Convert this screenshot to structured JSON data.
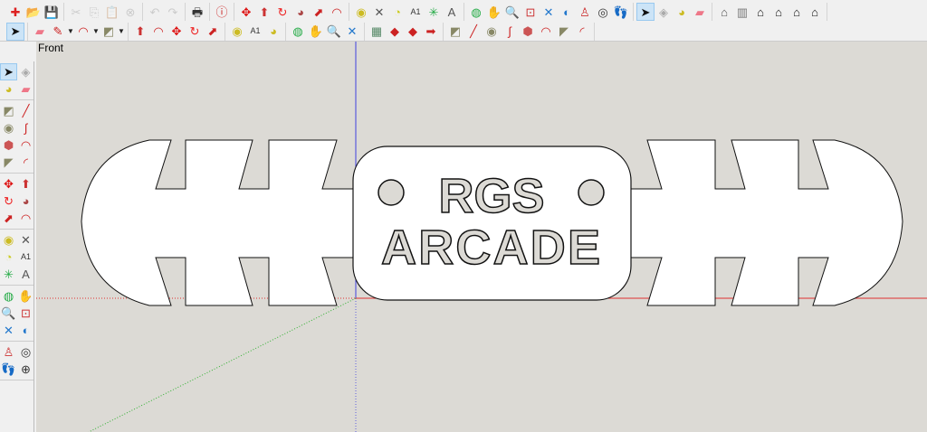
{
  "toolbar_row1": [
    [
      {
        "icon": "new-file-icon",
        "g": "✚",
        "c": "#d22"
      },
      {
        "icon": "open-folder-icon",
        "g": "📂",
        "c": "#6a5"
      },
      {
        "icon": "save-icon",
        "g": "💾",
        "c": "#247"
      }
    ],
    [
      {
        "icon": "cut-icon",
        "g": "✂",
        "c": "#888",
        "d": 1
      },
      {
        "icon": "copy-icon",
        "g": "⎘",
        "c": "#888",
        "d": 1
      },
      {
        "icon": "paste-icon",
        "g": "📋",
        "c": "#888",
        "d": 1
      },
      {
        "icon": "erase-icon",
        "g": "⊗",
        "c": "#888",
        "d": 1
      }
    ],
    [
      {
        "icon": "undo-icon",
        "g": "↶",
        "c": "#888",
        "d": 1
      },
      {
        "icon": "redo-icon",
        "g": "↷",
        "c": "#888",
        "d": 1
      }
    ],
    [
      {
        "icon": "print-icon",
        "g": "🖶",
        "c": "#333"
      }
    ],
    [
      {
        "icon": "model-info-icon",
        "g": "ⓘ",
        "c": "#c22"
      }
    ],
    [
      {
        "icon": "move-icon",
        "g": "✥",
        "c": "#d11"
      },
      {
        "icon": "push-pull-icon",
        "g": "⬆",
        "c": "#c33"
      },
      {
        "icon": "rotate-icon",
        "g": "↻",
        "c": "#e22"
      },
      {
        "icon": "follow-me-icon",
        "g": "◕",
        "c": "#a44"
      },
      {
        "icon": "scale-icon",
        "g": "⬈",
        "c": "#c22"
      },
      {
        "icon": "offset-icon",
        "g": "◠",
        "c": "#c22"
      }
    ],
    [
      {
        "icon": "tape-measure-icon",
        "g": "◉",
        "c": "#cb2"
      },
      {
        "icon": "dimension-icon",
        "g": "✕",
        "c": "#555"
      },
      {
        "icon": "protractor-icon",
        "g": "◔",
        "c": "#cc2"
      },
      {
        "icon": "text-icon",
        "g": "A1",
        "c": "#333"
      },
      {
        "icon": "axes-icon",
        "g": "✳",
        "c": "#2a4"
      },
      {
        "icon": "3d-text-icon",
        "g": "A",
        "c": "#555"
      }
    ],
    [
      {
        "icon": "orbit-icon",
        "g": "◍",
        "c": "#2a4"
      },
      {
        "icon": "pan-icon",
        "g": "✋",
        "c": "#777"
      },
      {
        "icon": "zoom-icon",
        "g": "🔍",
        "c": "#24a"
      },
      {
        "icon": "zoom-window-icon",
        "g": "⊡",
        "c": "#c33"
      },
      {
        "icon": "zoom-extents-icon",
        "g": "✕",
        "c": "#27c"
      },
      {
        "icon": "previous-view-icon",
        "g": "◐",
        "c": "#27c"
      },
      {
        "icon": "position-camera-icon",
        "g": "♙",
        "c": "#c33"
      },
      {
        "icon": "look-around-icon",
        "g": "◎",
        "c": "#333"
      },
      {
        "icon": "walk-icon",
        "g": "👣",
        "c": "#111"
      }
    ],
    [
      {
        "icon": "select-icon",
        "g": "➤",
        "c": "#111",
        "s": 1
      },
      {
        "icon": "make-component-icon",
        "g": "◈",
        "c": "#aaa"
      },
      {
        "icon": "paint-bucket-icon",
        "g": "◕",
        "c": "#cb2"
      },
      {
        "icon": "eraser-icon",
        "g": "▰",
        "c": "#e78"
      }
    ],
    [
      {
        "icon": "iso-view-icon",
        "g": "⌂",
        "c": "#555"
      },
      {
        "icon": "top-view-icon",
        "g": "▥",
        "c": "#777"
      },
      {
        "icon": "front-view-icon",
        "g": "⌂",
        "c": "#111"
      },
      {
        "icon": "right-view-icon",
        "g": "⌂",
        "c": "#111"
      },
      {
        "icon": "back-view-icon",
        "g": "⌂",
        "c": "#111"
      },
      {
        "icon": "left-view-icon",
        "g": "⌂",
        "c": "#111"
      }
    ]
  ],
  "toolbar_row2": [
    [
      {
        "icon": "select-icon",
        "g": "➤",
        "c": "#111",
        "s": 1
      }
    ],
    [
      {
        "icon": "eraser-icon",
        "g": "▰",
        "c": "#e78"
      },
      {
        "icon": "pencil-icon",
        "g": "✎",
        "c": "#c22",
        "dd": 1
      },
      {
        "icon": "arc-icon",
        "g": "◠",
        "c": "#c22",
        "dd": 1
      },
      {
        "icon": "rectangle-icon",
        "g": "◩",
        "c": "#886",
        "dd": 1
      }
    ],
    [
      {
        "icon": "push-pull-icon",
        "g": "⬆",
        "c": "#c33"
      },
      {
        "icon": "offset-icon",
        "g": "◠",
        "c": "#c22"
      },
      {
        "icon": "move-icon",
        "g": "✥",
        "c": "#d11"
      },
      {
        "icon": "rotate-icon",
        "g": "↻",
        "c": "#e22"
      },
      {
        "icon": "scale-icon",
        "g": "⬈",
        "c": "#c22"
      }
    ],
    [
      {
        "icon": "tape-measure-icon",
        "g": "◉",
        "c": "#cb2"
      },
      {
        "icon": "text-icon",
        "g": "A1",
        "c": "#333"
      },
      {
        "icon": "paint-bucket-icon",
        "g": "◕",
        "c": "#cb2"
      }
    ],
    [
      {
        "icon": "orbit-icon",
        "g": "◍",
        "c": "#2a4"
      },
      {
        "icon": "pan-icon",
        "g": "✋",
        "c": "#777"
      },
      {
        "icon": "zoom-icon",
        "g": "🔍",
        "c": "#24a"
      },
      {
        "icon": "zoom-extents-icon",
        "g": "✕",
        "c": "#27c"
      }
    ],
    [
      {
        "icon": "3d-warehouse-icon",
        "g": "▦",
        "c": "#586"
      },
      {
        "icon": "extension-warehouse-icon",
        "g": "◆",
        "c": "#c22"
      },
      {
        "icon": "share-model-icon",
        "g": "◆",
        "c": "#c22"
      },
      {
        "icon": "send-to-layout-icon",
        "g": "➡",
        "c": "#c22"
      }
    ],
    [
      {
        "icon": "rectangle-icon",
        "g": "◩",
        "c": "#886"
      },
      {
        "icon": "line-icon",
        "g": "╱",
        "c": "#c22"
      },
      {
        "icon": "circle-icon",
        "g": "◉",
        "c": "#886"
      },
      {
        "icon": "freehand-icon",
        "g": "∫",
        "c": "#c22"
      },
      {
        "icon": "polygon-icon",
        "g": "⬢",
        "c": "#c55"
      },
      {
        "icon": "arc-icon",
        "g": "◠",
        "c": "#c22"
      },
      {
        "icon": "pie-icon",
        "g": "◤",
        "c": "#886"
      },
      {
        "icon": "two-point-arc-icon",
        "g": "◜",
        "c": "#c22"
      }
    ]
  ],
  "left_toolbar": [
    [
      {
        "icon": "select-icon",
        "g": "➤",
        "c": "#111",
        "s": 1
      },
      {
        "icon": "make-component-icon",
        "g": "◈",
        "c": "#aaa"
      },
      {
        "icon": "paint-bucket-icon",
        "g": "◕",
        "c": "#cb2"
      },
      {
        "icon": "eraser-icon",
        "g": "▰",
        "c": "#e78"
      }
    ],
    [
      {
        "icon": "rectangle-icon",
        "g": "◩",
        "c": "#886"
      },
      {
        "icon": "line-icon",
        "g": "╱",
        "c": "#c22"
      },
      {
        "icon": "circle-icon",
        "g": "◉",
        "c": "#886"
      },
      {
        "icon": "freehand-icon",
        "g": "∫",
        "c": "#c22"
      },
      {
        "icon": "polygon-icon",
        "g": "⬢",
        "c": "#c55"
      },
      {
        "icon": "arc-icon",
        "g": "◠",
        "c": "#c22"
      },
      {
        "icon": "pie-icon",
        "g": "◤",
        "c": "#886"
      },
      {
        "icon": "two-point-arc-icon",
        "g": "◜",
        "c": "#c22"
      }
    ],
    [
      {
        "icon": "move-icon",
        "g": "✥",
        "c": "#d11"
      },
      {
        "icon": "push-pull-icon",
        "g": "⬆",
        "c": "#c33"
      },
      {
        "icon": "rotate-icon",
        "g": "↻",
        "c": "#e22"
      },
      {
        "icon": "follow-me-icon",
        "g": "◕",
        "c": "#a44"
      },
      {
        "icon": "scale-icon",
        "g": "⬈",
        "c": "#c22"
      },
      {
        "icon": "offset-icon",
        "g": "◠",
        "c": "#c22"
      }
    ],
    [
      {
        "icon": "tape-measure-icon",
        "g": "◉",
        "c": "#cb2"
      },
      {
        "icon": "dimension-icon",
        "g": "✕",
        "c": "#555"
      },
      {
        "icon": "protractor-icon",
        "g": "◔",
        "c": "#cc2"
      },
      {
        "icon": "text-icon",
        "g": "A1",
        "c": "#333"
      },
      {
        "icon": "axes-icon",
        "g": "✳",
        "c": "#2a4"
      },
      {
        "icon": "3d-text-icon",
        "g": "A",
        "c": "#555"
      }
    ],
    [
      {
        "icon": "orbit-icon",
        "g": "◍",
        "c": "#2a4"
      },
      {
        "icon": "pan-icon",
        "g": "✋",
        "c": "#777"
      },
      {
        "icon": "zoom-icon",
        "g": "🔍",
        "c": "#24a"
      },
      {
        "icon": "zoom-window-icon",
        "g": "⊡",
        "c": "#c33"
      },
      {
        "icon": "zoom-extents-icon",
        "g": "✕",
        "c": "#27c"
      },
      {
        "icon": "previous-view-icon",
        "g": "◐",
        "c": "#27c"
      }
    ],
    [
      {
        "icon": "position-camera-icon",
        "g": "♙",
        "c": "#c33"
      },
      {
        "icon": "look-around-icon",
        "g": "◎",
        "c": "#333"
      },
      {
        "icon": "walk-icon",
        "g": "👣",
        "c": "#111"
      },
      {
        "icon": "section-plane-icon",
        "g": "⊕",
        "c": "#333"
      }
    ]
  ],
  "viewport": {
    "scene_label": "Front",
    "model_text_line1": "RGS",
    "model_text_line2": "ARCADE"
  },
  "colors": {
    "background": "#dcdad5",
    "face": "#ffffff",
    "x_axis": "#e03030",
    "y_axis": "#30b030",
    "z_axis": "#3030e0"
  }
}
